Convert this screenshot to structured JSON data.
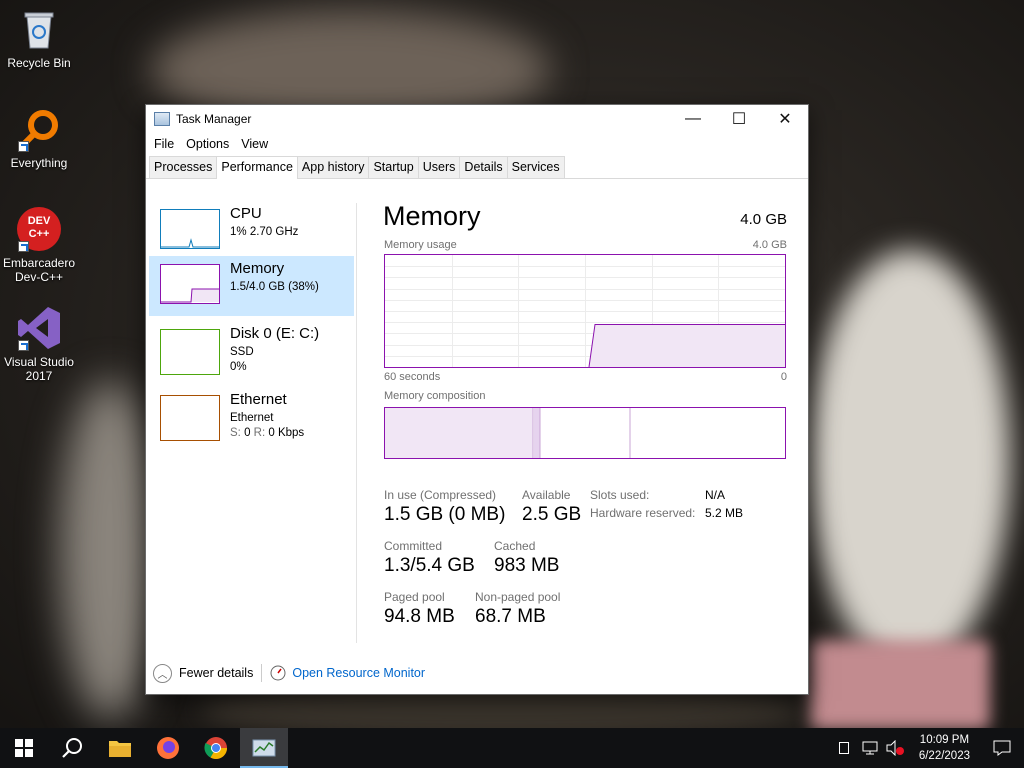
{
  "desktop": {
    "icons": [
      {
        "label": "Recycle Bin"
      },
      {
        "label": "Everything"
      },
      {
        "label": "Embarcadero Dev-C++",
        "glyph_text": "DEV C++"
      },
      {
        "label": "Visual Studio 2017"
      }
    ]
  },
  "window": {
    "title": "Task Manager",
    "menu": [
      "File",
      "Options",
      "View"
    ],
    "tabs": [
      "Processes",
      "Performance",
      "App history",
      "Startup",
      "Users",
      "Details",
      "Services"
    ],
    "active_tab": "Performance",
    "controls": {
      "minimize": "—",
      "maximize": "☐",
      "close": "✕"
    }
  },
  "resources": [
    {
      "name": "CPU",
      "line1": "1% 2.70 GHz",
      "line2": "",
      "color": "#117dbb"
    },
    {
      "name": "Memory",
      "line1": "1.5/4.0 GB (38%)",
      "line2": "",
      "color": "#8b12ae",
      "selected": true
    },
    {
      "name": "Disk 0 (E: C:)",
      "line1": "SSD",
      "line2": "0%",
      "color": "#4da60c"
    },
    {
      "name": "Ethernet",
      "line1": "Ethernet",
      "line2_prefix": "S:",
      "line2": " 0 ",
      "line2_mid": "R:",
      "line2_end": " 0 Kbps",
      "color": "#a74f01"
    }
  ],
  "memory": {
    "title": "Memory",
    "total": "4.0 GB",
    "usage_label": "Memory usage",
    "usage_max": "4.0 GB",
    "x_left": "60 seconds",
    "x_right": "0",
    "composition_label": "Memory composition",
    "usage_fraction": 0.38,
    "stats": {
      "in_use_label": "In use (Compressed)",
      "in_use": "1.5 GB (0 MB)",
      "available_label": "Available",
      "available": "2.5 GB",
      "committed_label": "Committed",
      "committed": "1.3/5.4 GB",
      "cached_label": "Cached",
      "cached": "983 MB",
      "paged_label": "Paged pool",
      "paged": "94.8 MB",
      "nonpaged_label": "Non-paged pool",
      "nonpaged": "68.7 MB",
      "slots_label": "Slots used:",
      "slots": "N/A",
      "hw_label": "Hardware reserved:",
      "hw": "5.2 MB"
    }
  },
  "footer": {
    "fewer_details": "Fewer details",
    "open_monitor": "Open Resource Monitor"
  },
  "taskbar": {
    "time": "10:09 PM",
    "date": "6/22/2023"
  }
}
